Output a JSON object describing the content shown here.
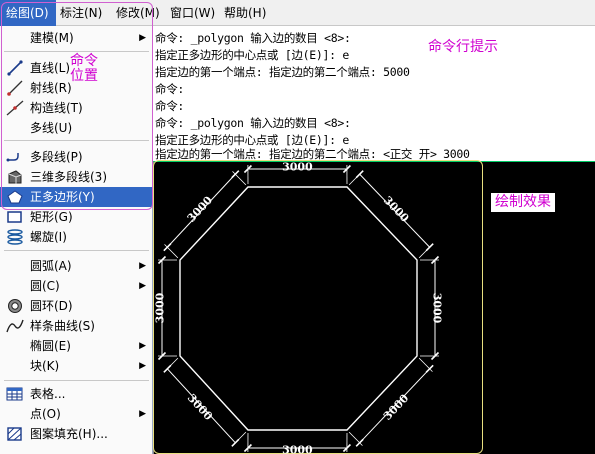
{
  "menubar": {
    "items": [
      "绘图(D)",
      "标注(N)",
      "修改(M)",
      "窗口(W)",
      "帮助(H)"
    ]
  },
  "menu": {
    "items": [
      {
        "label": "建模(M)",
        "icon": "",
        "submenu": true
      },
      {
        "label": "直线(L)",
        "icon": "line-icon",
        "submenu": false
      },
      {
        "label": "射线(R)",
        "icon": "ray-icon",
        "submenu": false
      },
      {
        "label": "构造线(T)",
        "icon": "xline-icon",
        "submenu": false
      },
      {
        "label": "多线(U)",
        "icon": "",
        "submenu": false
      },
      {
        "label": "多段线(P)",
        "icon": "polyline-icon",
        "submenu": false
      },
      {
        "label": "三维多段线(3)",
        "icon": "3d-polyline-icon",
        "submenu": false
      },
      {
        "label": "正多边形(Y)",
        "icon": "polygon-icon",
        "submenu": false,
        "selected": true
      },
      {
        "label": "矩形(G)",
        "icon": "rectangle-icon",
        "submenu": false
      },
      {
        "label": "螺旋(I)",
        "icon": "helix-icon",
        "submenu": false
      },
      {
        "label": "圆弧(A)",
        "icon": "",
        "submenu": true
      },
      {
        "label": "圆(C)",
        "icon": "",
        "submenu": true
      },
      {
        "label": "圆环(D)",
        "icon": "donut-icon",
        "submenu": false
      },
      {
        "label": "样条曲线(S)",
        "icon": "spline-icon",
        "submenu": false
      },
      {
        "label": "椭圆(E)",
        "icon": "",
        "submenu": true
      },
      {
        "label": "块(K)",
        "icon": "",
        "submenu": true
      },
      {
        "label": "表格...",
        "icon": "table-icon",
        "submenu": false
      },
      {
        "label": "点(O)",
        "icon": "",
        "submenu": true
      },
      {
        "label": "图案填充(H)...",
        "icon": "hatch-icon",
        "submenu": false
      }
    ],
    "annotation_line1": "命令",
    "annotation_line2": "位置"
  },
  "command": {
    "lines": [
      "命令: _polygon 输入边的数目 <8>:",
      "指定正多边形的中心点或 [边(E)]: e",
      "指定边的第一个端点: 指定边的第二个端点: 5000",
      "命令:",
      "命令:",
      "命令: _polygon 输入边的数目 <8>:",
      "指定正多边形的中心点或 [边(E)]: e",
      "指定边的第一个端点: 指定边的第二个端点: <正交 开> 3000"
    ],
    "annotation": "命令行提示"
  },
  "canvas": {
    "label": "绘制效果",
    "dimension_text": "3000",
    "sides": 8,
    "dimensions_shown": 8
  },
  "colors": {
    "selection": "#3167c4",
    "annotation": "#d000d0",
    "canvas_bg": "#000000",
    "drawing": "#ffffff"
  }
}
